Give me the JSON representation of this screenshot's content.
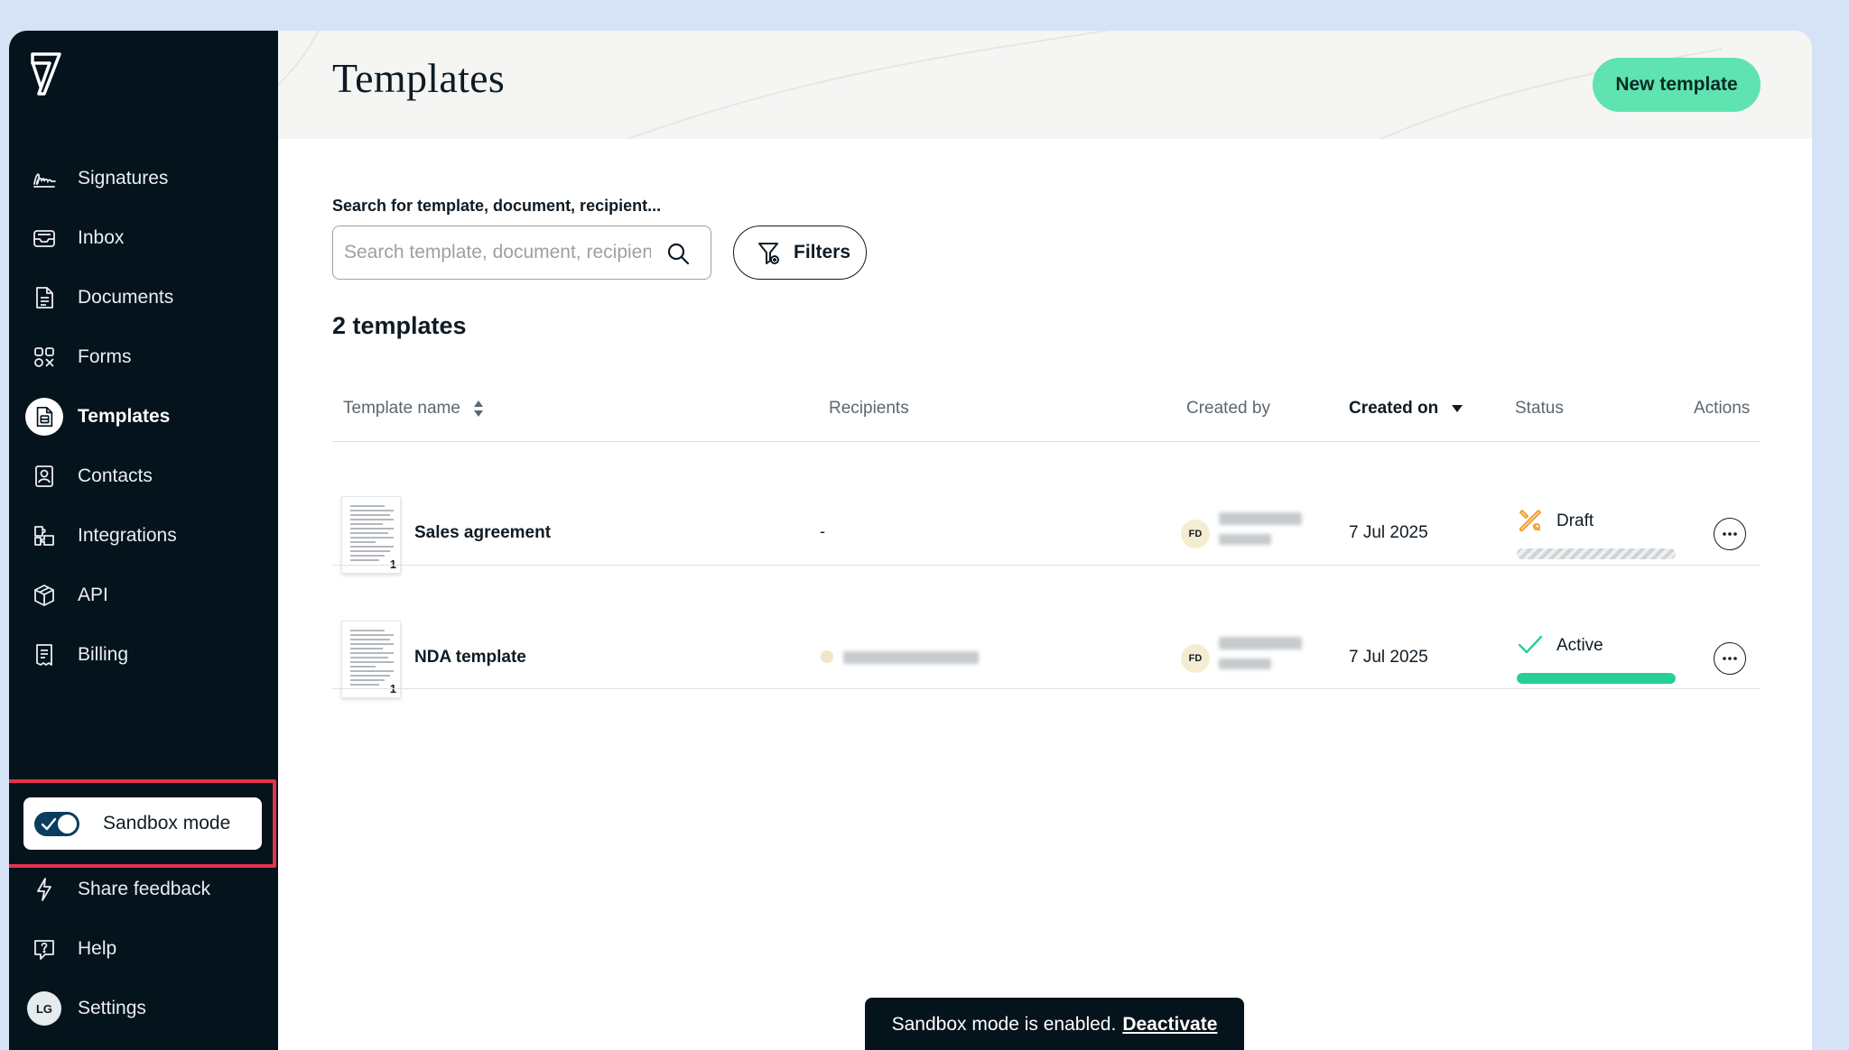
{
  "sidebar": {
    "logo": "velvet-logo",
    "items": [
      {
        "label": "Signatures",
        "icon": "signature-icon"
      },
      {
        "label": "Inbox",
        "icon": "inbox-icon"
      },
      {
        "label": "Documents",
        "icon": "document-icon"
      },
      {
        "label": "Forms",
        "icon": "forms-icon"
      },
      {
        "label": "Templates",
        "icon": "templates-icon",
        "active": true
      },
      {
        "label": "Contacts",
        "icon": "contacts-icon"
      },
      {
        "label": "Integrations",
        "icon": "integrations-icon"
      },
      {
        "label": "API",
        "icon": "api-icon"
      },
      {
        "label": "Billing",
        "icon": "billing-icon"
      }
    ],
    "sandbox": {
      "label": "Sandbox mode",
      "enabled": true
    },
    "footer": [
      {
        "label": "Share feedback",
        "icon": "lightning-icon"
      },
      {
        "label": "Help",
        "icon": "help-icon"
      },
      {
        "label": "Settings",
        "icon": "avatar",
        "avatar_initials": "LG"
      }
    ]
  },
  "header": {
    "title": "Templates",
    "new_button": "New template"
  },
  "search": {
    "label": "Search for template, document, recipient...",
    "placeholder": "Search template, document, recipient...",
    "value": "",
    "filters_label": "Filters"
  },
  "list": {
    "count_label": "2 templates",
    "columns": [
      "Template name",
      "Recipients",
      "Created by",
      "Created on",
      "Status",
      "Actions"
    ],
    "sorted_column": "Created on",
    "rows": [
      {
        "name": "Sales agreement",
        "pages": "1",
        "recipients": "-",
        "creator_initials": "FD",
        "created_on": "7 Jul 2025",
        "status": "Draft",
        "status_icon": "draft-icon",
        "progress": 0
      },
      {
        "name": "NDA template",
        "pages": "1",
        "recipients": "",
        "creator_initials": "FD",
        "created_on": "7 Jul 2025",
        "status": "Active",
        "status_icon": "check-icon",
        "progress": 1.0
      }
    ]
  },
  "toast": {
    "message": "Sandbox mode is enabled.",
    "action": "Deactivate"
  },
  "colors": {
    "sidebar_bg": "#04131c",
    "accent_green": "#5ee3b1",
    "active_bar": "#27cf95",
    "highlight_red": "#e3334c",
    "page_bg": "#d6e3f6",
    "draft_icon": "#f0a030"
  }
}
